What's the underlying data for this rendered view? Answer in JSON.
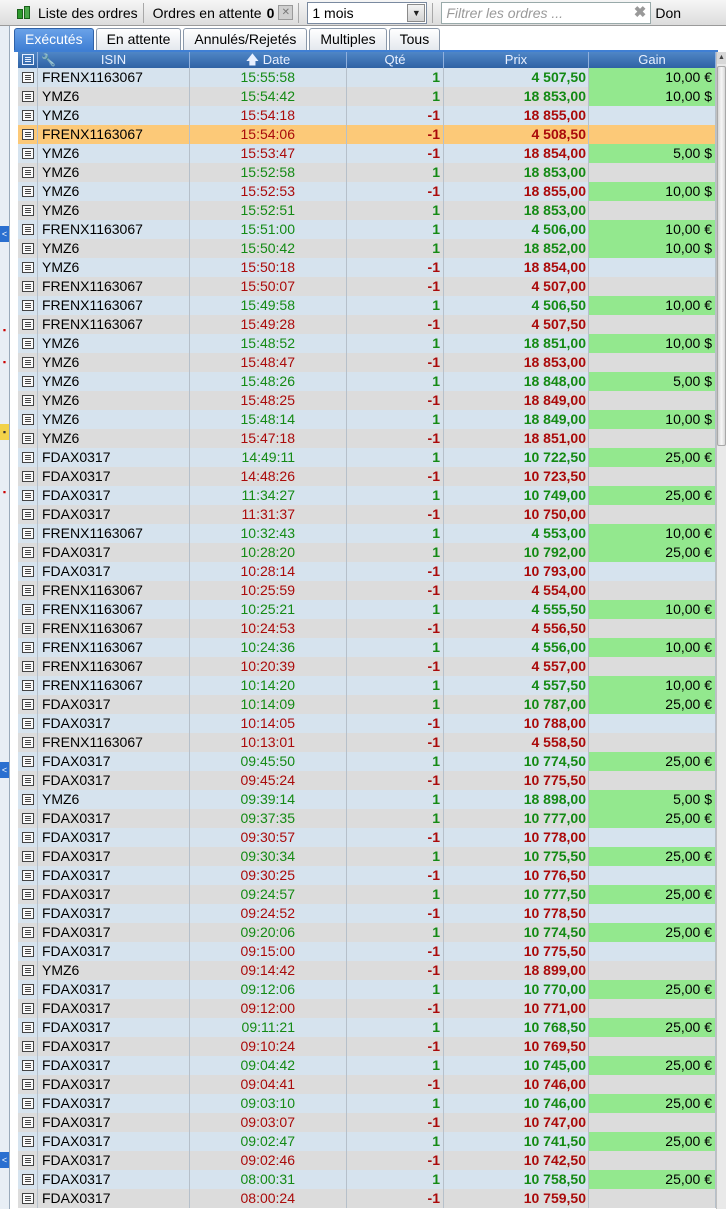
{
  "toolbar": {
    "title": "Liste des ordres",
    "pending_label": "Ordres en attente",
    "pending_count": "0",
    "period_value": "1 mois",
    "filter_placeholder": "Filtrer les ordres ...",
    "tail_text": "Don"
  },
  "tabs": [
    {
      "label": "Exécutés",
      "active": true
    },
    {
      "label": "En attente",
      "active": false
    },
    {
      "label": "Annulés/Rejetés",
      "active": false
    },
    {
      "label": "Multiples",
      "active": false
    },
    {
      "label": "Tous",
      "active": false
    }
  ],
  "columns": {
    "isin": "ISIN",
    "date": "Date",
    "qty": "Qté",
    "price": "Prix",
    "gain": "Gain"
  },
  "colors": {
    "buy": "#148a14",
    "sell": "#aa0a0a",
    "gain_bg": "#93e88e",
    "selected": "#fcc978",
    "accent": "#3f7fd4"
  },
  "selected_row": 3,
  "rows": [
    [
      "FRENX1163067",
      "15:55:58",
      "1",
      "4 507,50",
      "10,00 €"
    ],
    [
      "YMZ6",
      "15:54:42",
      "1",
      "18 853,00",
      "10,00 $"
    ],
    [
      "YMZ6",
      "15:54:18",
      "-1",
      "18 855,00",
      ""
    ],
    [
      "FRENX1163067",
      "15:54:06",
      "-1",
      "4 508,50",
      ""
    ],
    [
      "YMZ6",
      "15:53:47",
      "-1",
      "18 854,00",
      "5,00 $"
    ],
    [
      "YMZ6",
      "15:52:58",
      "1",
      "18 853,00",
      ""
    ],
    [
      "YMZ6",
      "15:52:53",
      "-1",
      "18 855,00",
      "10,00 $"
    ],
    [
      "YMZ6",
      "15:52:51",
      "1",
      "18 853,00",
      ""
    ],
    [
      "FRENX1163067",
      "15:51:00",
      "1",
      "4 506,00",
      "10,00 €"
    ],
    [
      "YMZ6",
      "15:50:42",
      "1",
      "18 852,00",
      "10,00 $"
    ],
    [
      "YMZ6",
      "15:50:18",
      "-1",
      "18 854,00",
      ""
    ],
    [
      "FRENX1163067",
      "15:50:07",
      "-1",
      "4 507,00",
      ""
    ],
    [
      "FRENX1163067",
      "15:49:58",
      "1",
      "4 506,50",
      "10,00 €"
    ],
    [
      "FRENX1163067",
      "15:49:28",
      "-1",
      "4 507,50",
      ""
    ],
    [
      "YMZ6",
      "15:48:52",
      "1",
      "18 851,00",
      "10,00 $"
    ],
    [
      "YMZ6",
      "15:48:47",
      "-1",
      "18 853,00",
      ""
    ],
    [
      "YMZ6",
      "15:48:26",
      "1",
      "18 848,00",
      "5,00 $"
    ],
    [
      "YMZ6",
      "15:48:25",
      "-1",
      "18 849,00",
      ""
    ],
    [
      "YMZ6",
      "15:48:14",
      "1",
      "18 849,00",
      "10,00 $"
    ],
    [
      "YMZ6",
      "15:47:18",
      "-1",
      "18 851,00",
      ""
    ],
    [
      "FDAX0317",
      "14:49:11",
      "1",
      "10 722,50",
      "25,00 €"
    ],
    [
      "FDAX0317",
      "14:48:26",
      "-1",
      "10 723,50",
      ""
    ],
    [
      "FDAX0317",
      "11:34:27",
      "1",
      "10 749,00",
      "25,00 €"
    ],
    [
      "FDAX0317",
      "11:31:37",
      "-1",
      "10 750,00",
      ""
    ],
    [
      "FRENX1163067",
      "10:32:43",
      "1",
      "4 553,00",
      "10,00 €"
    ],
    [
      "FDAX0317",
      "10:28:20",
      "1",
      "10 792,00",
      "25,00 €"
    ],
    [
      "FDAX0317",
      "10:28:14",
      "-1",
      "10 793,00",
      ""
    ],
    [
      "FRENX1163067",
      "10:25:59",
      "-1",
      "4 554,00",
      ""
    ],
    [
      "FRENX1163067",
      "10:25:21",
      "1",
      "4 555,50",
      "10,00 €"
    ],
    [
      "FRENX1163067",
      "10:24:53",
      "-1",
      "4 556,50",
      ""
    ],
    [
      "FRENX1163067",
      "10:24:36",
      "1",
      "4 556,00",
      "10,00 €"
    ],
    [
      "FRENX1163067",
      "10:20:39",
      "-1",
      "4 557,00",
      ""
    ],
    [
      "FRENX1163067",
      "10:14:20",
      "1",
      "4 557,50",
      "10,00 €"
    ],
    [
      "FDAX0317",
      "10:14:09",
      "1",
      "10 787,00",
      "25,00 €"
    ],
    [
      "FDAX0317",
      "10:14:05",
      "-1",
      "10 788,00",
      ""
    ],
    [
      "FRENX1163067",
      "10:13:01",
      "-1",
      "4 558,50",
      ""
    ],
    [
      "FDAX0317",
      "09:45:50",
      "1",
      "10 774,50",
      "25,00 €"
    ],
    [
      "FDAX0317",
      "09:45:24",
      "-1",
      "10 775,50",
      ""
    ],
    [
      "YMZ6",
      "09:39:14",
      "1",
      "18 898,00",
      "5,00 $"
    ],
    [
      "FDAX0317",
      "09:37:35",
      "1",
      "10 777,00",
      "25,00 €"
    ],
    [
      "FDAX0317",
      "09:30:57",
      "-1",
      "10 778,00",
      ""
    ],
    [
      "FDAX0317",
      "09:30:34",
      "1",
      "10 775,50",
      "25,00 €"
    ],
    [
      "FDAX0317",
      "09:30:25",
      "-1",
      "10 776,50",
      ""
    ],
    [
      "FDAX0317",
      "09:24:57",
      "1",
      "10 777,50",
      "25,00 €"
    ],
    [
      "FDAX0317",
      "09:24:52",
      "-1",
      "10 778,50",
      ""
    ],
    [
      "FDAX0317",
      "09:20:06",
      "1",
      "10 774,50",
      "25,00 €"
    ],
    [
      "FDAX0317",
      "09:15:00",
      "-1",
      "10 775,50",
      ""
    ],
    [
      "YMZ6",
      "09:14:42",
      "-1",
      "18 899,00",
      ""
    ],
    [
      "FDAX0317",
      "09:12:06",
      "1",
      "10 770,00",
      "25,00 €"
    ],
    [
      "FDAX0317",
      "09:12:00",
      "-1",
      "10 771,00",
      ""
    ],
    [
      "FDAX0317",
      "09:11:21",
      "1",
      "10 768,50",
      "25,00 €"
    ],
    [
      "FDAX0317",
      "09:10:24",
      "-1",
      "10 769,50",
      ""
    ],
    [
      "FDAX0317",
      "09:04:42",
      "1",
      "10 745,00",
      "25,00 €"
    ],
    [
      "FDAX0317",
      "09:04:41",
      "-1",
      "10 746,00",
      ""
    ],
    [
      "FDAX0317",
      "09:03:10",
      "1",
      "10 746,00",
      "25,00 €"
    ],
    [
      "FDAX0317",
      "09:03:07",
      "-1",
      "10 747,00",
      ""
    ],
    [
      "FDAX0317",
      "09:02:47",
      "1",
      "10 741,50",
      "25,00 €"
    ],
    [
      "FDAX0317",
      "09:02:46",
      "-1",
      "10 742,50",
      ""
    ],
    [
      "FDAX0317",
      "08:00:31",
      "1",
      "10 758,50",
      "25,00 €"
    ],
    [
      "FDAX0317",
      "08:00:24",
      "-1",
      "10 759,50",
      ""
    ]
  ]
}
